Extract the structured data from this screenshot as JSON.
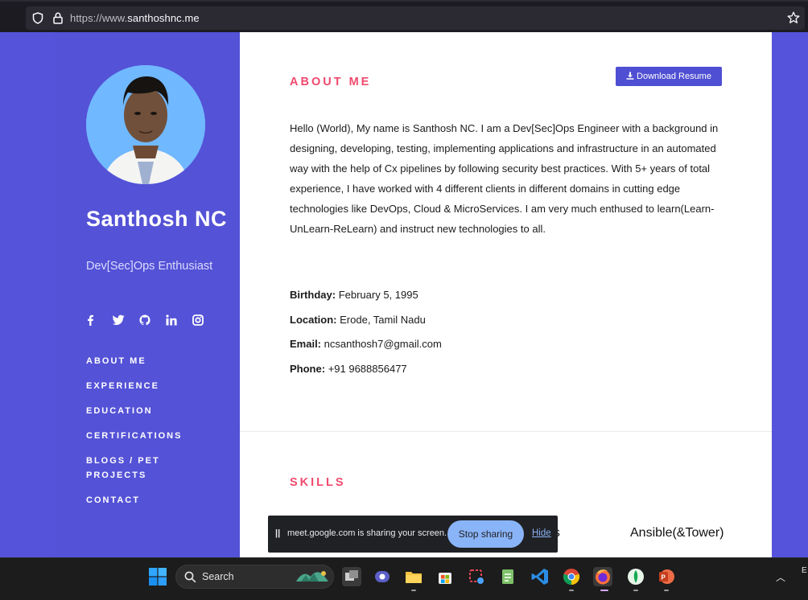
{
  "browser": {
    "url_dim": "https://www.",
    "url_main": "santhoshnc.me"
  },
  "profile": {
    "name": "Santhosh NC",
    "tagline": "Dev[Sec]Ops Enthusiast",
    "social": [
      "f",
      "t",
      "gh",
      "in",
      "ig"
    ]
  },
  "nav": [
    "ABOUT ME",
    "EXPERIENCE",
    "EDUCATION",
    "CERTIFICATIONS",
    "BLOGS / PET PROJECTS",
    "CONTACT"
  ],
  "about": {
    "title": "ABOUT ME",
    "download_label": "Download Resume",
    "paragraph": "Hello (World), My name is Santhosh NC. I am a Dev[Sec]Ops Engineer with a background in designing, developing, testing, implementing applications and infrastructure in an automated way with the help of Cx pipelines by following security best practices. With 5+ years of total experience, I have worked with 4 different clients in different domains in cutting edge technologies like DevOps, Cloud & MicroServices. I am very much enthused to learn(Learn-UnLearn-ReLearn) and instruct new technologies to all.",
    "birthday_label": "Birthday:",
    "birthday": "February 5, 1995",
    "location_label": "Location:",
    "location": "Erode, Tamil Nadu",
    "email_label": "Email:",
    "email": "ncsanthosh7@gmail.com",
    "phone_label": "Phone:",
    "phone": "+91 9688856477"
  },
  "skills": {
    "title": "SKILLS",
    "visible": [
      "ns",
      "Ansible(&Tower)"
    ]
  },
  "share_banner": {
    "pause": "||",
    "message": "meet.google.com is sharing your screen.",
    "stop_label": "Stop sharing",
    "hide_label": "Hide"
  },
  "taskbar": {
    "search_label": "Search",
    "tray_text": "E"
  },
  "colors": {
    "accent": "#5653db",
    "section_title": "#f04a6e",
    "button": "#4f4fd3"
  }
}
